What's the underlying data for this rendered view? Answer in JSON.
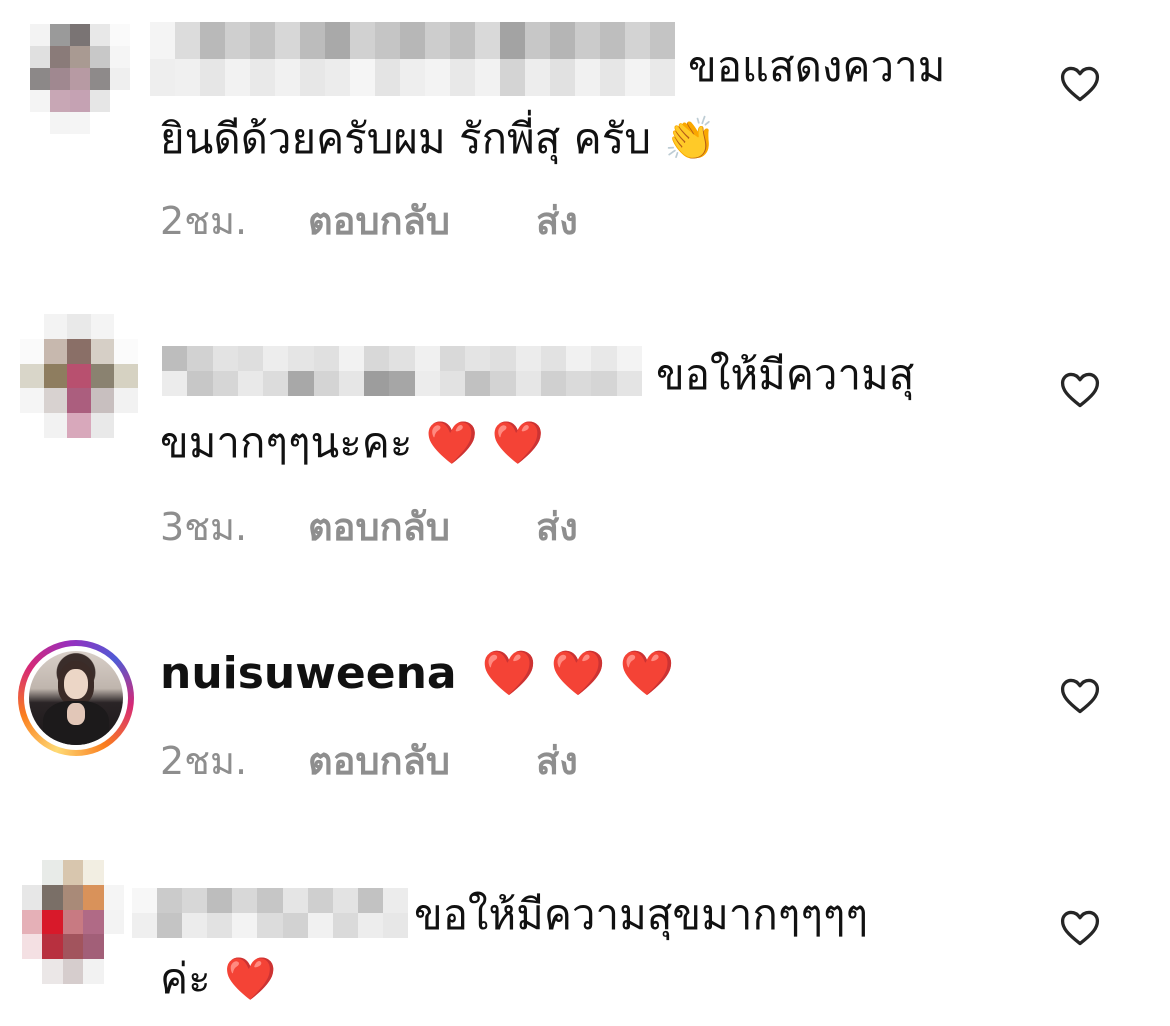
{
  "comments": [
    {
      "username_blurred": true,
      "text_line1": "ขอแสดงความ",
      "text_line2": "ยินดีด้วยครับผม รักพี่สุ ครับ",
      "emoji": "👏",
      "time": "2ชม.",
      "reply_label": "ตอบกลับ",
      "send_label": "ส่ง",
      "like_icon": "heart-outline-icon"
    },
    {
      "username_blurred": true,
      "text_line1": "ขอให้มีความสุ",
      "text_line2": "ขมากๆๆนะคะ",
      "emoji": "❤️ ❤️",
      "time": "3ชม.",
      "reply_label": "ตอบกลับ",
      "send_label": "ส่ง",
      "like_icon": "heart-outline-icon"
    },
    {
      "username": "nuisuweena",
      "emoji": "❤️ ❤️ ❤️",
      "time": "2ชม.",
      "reply_label": "ตอบกลับ",
      "send_label": "ส่ง",
      "like_icon": "heart-outline-icon",
      "story_ring": true
    },
    {
      "username_blurred": true,
      "text_line1": "ขอให้มีความสุขมากๆๆๆๆ",
      "text_line2": "ค่ะ",
      "emoji": "❤️",
      "like_icon": "heart-outline-icon"
    }
  ],
  "colors": {
    "meta_text": "#8e8e8e",
    "heart_red": "#e0245e",
    "icon_stroke": "#262626"
  }
}
